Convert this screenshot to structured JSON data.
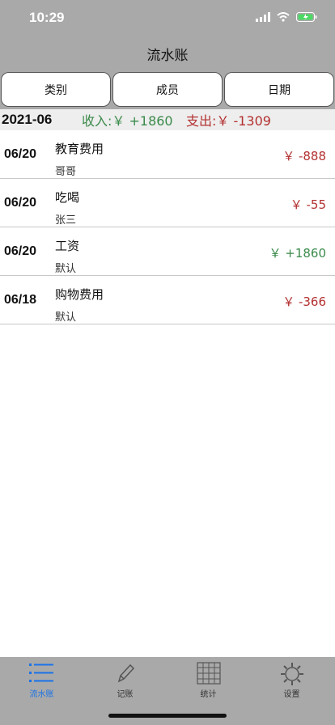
{
  "status_bar": {
    "time": "10:29"
  },
  "header": {
    "title": "流水账"
  },
  "filters": [
    {
      "label": "类别"
    },
    {
      "label": "成员"
    },
    {
      "label": "日期"
    }
  ],
  "summary": {
    "month": "2021-06",
    "income": "收入:￥ +1860",
    "expense": "支出:￥ -1309"
  },
  "entries": [
    {
      "date": "06/20",
      "category": "教育费用",
      "member": "哥哥",
      "amount": "￥ -888",
      "type": "expense"
    },
    {
      "date": "06/20",
      "category": "吃喝",
      "member": "张三",
      "amount": "￥ -55",
      "type": "expense"
    },
    {
      "date": "06/20",
      "category": "工资",
      "member": "默认",
      "amount": "￥ +1860",
      "type": "income"
    },
    {
      "date": "06/18",
      "category": "购物费用",
      "member": "默认",
      "amount": "￥ -366",
      "type": "expense"
    }
  ],
  "tabbar": {
    "tabs": [
      {
        "label": "流水账",
        "icon": "list-icon",
        "active": true
      },
      {
        "label": "记账",
        "icon": "pencil-icon",
        "active": false
      },
      {
        "label": "统计",
        "icon": "grid-icon",
        "active": false
      },
      {
        "label": "设置",
        "icon": "gear-icon",
        "active": false
      }
    ]
  },
  "colors": {
    "header_bg": "#a9a9a9",
    "income": "#3a8a4a",
    "expense": "#b33030",
    "active_tab": "#1a73e8"
  }
}
